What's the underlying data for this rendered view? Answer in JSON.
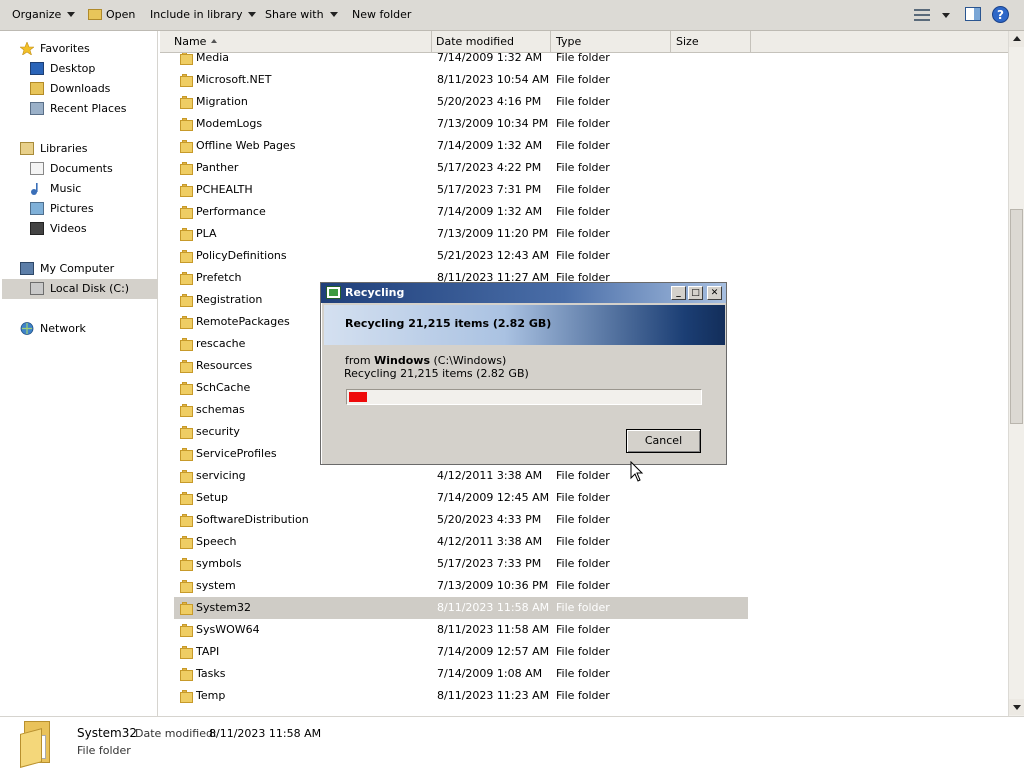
{
  "toolbar": {
    "organize": "Organize",
    "open": "Open",
    "include_in_library": "Include in library",
    "share_with": "Share with",
    "new_folder": "New folder"
  },
  "nav": {
    "favorites": "Favorites",
    "desktop": "Desktop",
    "downloads": "Downloads",
    "recent_places": "Recent Places",
    "libraries": "Libraries",
    "documents": "Documents",
    "music": "Music",
    "pictures": "Pictures",
    "videos": "Videos",
    "my_computer": "My Computer",
    "local_disk": "Local Disk (C:)",
    "network": "Network"
  },
  "columns": {
    "name": "Name",
    "date_modified": "Date modified",
    "type": "Type",
    "size": "Size"
  },
  "files": [
    {
      "name": "Media",
      "date": "7/14/2009 1:32 AM",
      "type": "File folder"
    },
    {
      "name": "Microsoft.NET",
      "date": "8/11/2023 10:54 AM",
      "type": "File folder"
    },
    {
      "name": "Migration",
      "date": "5/20/2023 4:16 PM",
      "type": "File folder"
    },
    {
      "name": "ModemLogs",
      "date": "7/13/2009 10:34 PM",
      "type": "File folder"
    },
    {
      "name": "Offline Web Pages",
      "date": "7/14/2009 1:32 AM",
      "type": "File folder"
    },
    {
      "name": "Panther",
      "date": "5/17/2023 4:22 PM",
      "type": "File folder"
    },
    {
      "name": "PCHEALTH",
      "date": "5/17/2023 7:31 PM",
      "type": "File folder"
    },
    {
      "name": "Performance",
      "date": "7/14/2009 1:32 AM",
      "type": "File folder"
    },
    {
      "name": "PLA",
      "date": "7/13/2009 11:20 PM",
      "type": "File folder"
    },
    {
      "name": "PolicyDefinitions",
      "date": "5/21/2023 12:43 AM",
      "type": "File folder"
    },
    {
      "name": "Prefetch",
      "date": "8/11/2023 11:27 AM",
      "type": "File folder"
    },
    {
      "name": "Registration",
      "date": "",
      "type": ""
    },
    {
      "name": "RemotePackages",
      "date": "",
      "type": ""
    },
    {
      "name": "rescache",
      "date": "",
      "type": ""
    },
    {
      "name": "Resources",
      "date": "",
      "type": ""
    },
    {
      "name": "SchCache",
      "date": "",
      "type": ""
    },
    {
      "name": "schemas",
      "date": "",
      "type": ""
    },
    {
      "name": "security",
      "date": "",
      "type": ""
    },
    {
      "name": "ServiceProfiles",
      "date": "",
      "type": ""
    },
    {
      "name": "servicing",
      "date": "4/12/2011 3:38 AM",
      "type": "File folder"
    },
    {
      "name": "Setup",
      "date": "7/14/2009 12:45 AM",
      "type": "File folder"
    },
    {
      "name": "SoftwareDistribution",
      "date": "5/20/2023 4:33 PM",
      "type": "File folder"
    },
    {
      "name": "Speech",
      "date": "4/12/2011 3:38 AM",
      "type": "File folder"
    },
    {
      "name": "symbols",
      "date": "5/17/2023 7:33 PM",
      "type": "File folder"
    },
    {
      "name": "system",
      "date": "7/13/2009 10:36 PM",
      "type": "File folder"
    },
    {
      "name": "System32",
      "date": "8/11/2023 11:58 AM",
      "type": "File folder",
      "selected": true
    },
    {
      "name": "SysWOW64",
      "date": "8/11/2023 11:58 AM",
      "type": "File folder"
    },
    {
      "name": "TAPI",
      "date": "7/14/2009 12:57 AM",
      "type": "File folder"
    },
    {
      "name": "Tasks",
      "date": "7/14/2009 1:08 AM",
      "type": "File folder"
    },
    {
      "name": "Temp",
      "date": "8/11/2023 11:23 AM",
      "type": "File folder"
    }
  ],
  "details": {
    "name": "System32",
    "date_label": "Date modified:",
    "date_value": "8/11/2023 11:58 AM",
    "type": "File folder"
  },
  "dialog": {
    "title": "Recycling",
    "headline": "Recycling 21,215 items (2.82 GB)",
    "from_prefix": "from",
    "from_source": "Windows",
    "from_path": "(C:\\Windows)",
    "status": "Recycling 21,215 items (2.82 GB)",
    "progress_fraction": 0.05,
    "cancel": "Cancel",
    "minimize_glyph": "_",
    "maximize_glyph": "□",
    "close_glyph": "✕"
  },
  "colors": {
    "progress_fill": "#ee0a0a",
    "selection": "#cfccc6",
    "title_gradient_start": "#1f3f7a"
  }
}
